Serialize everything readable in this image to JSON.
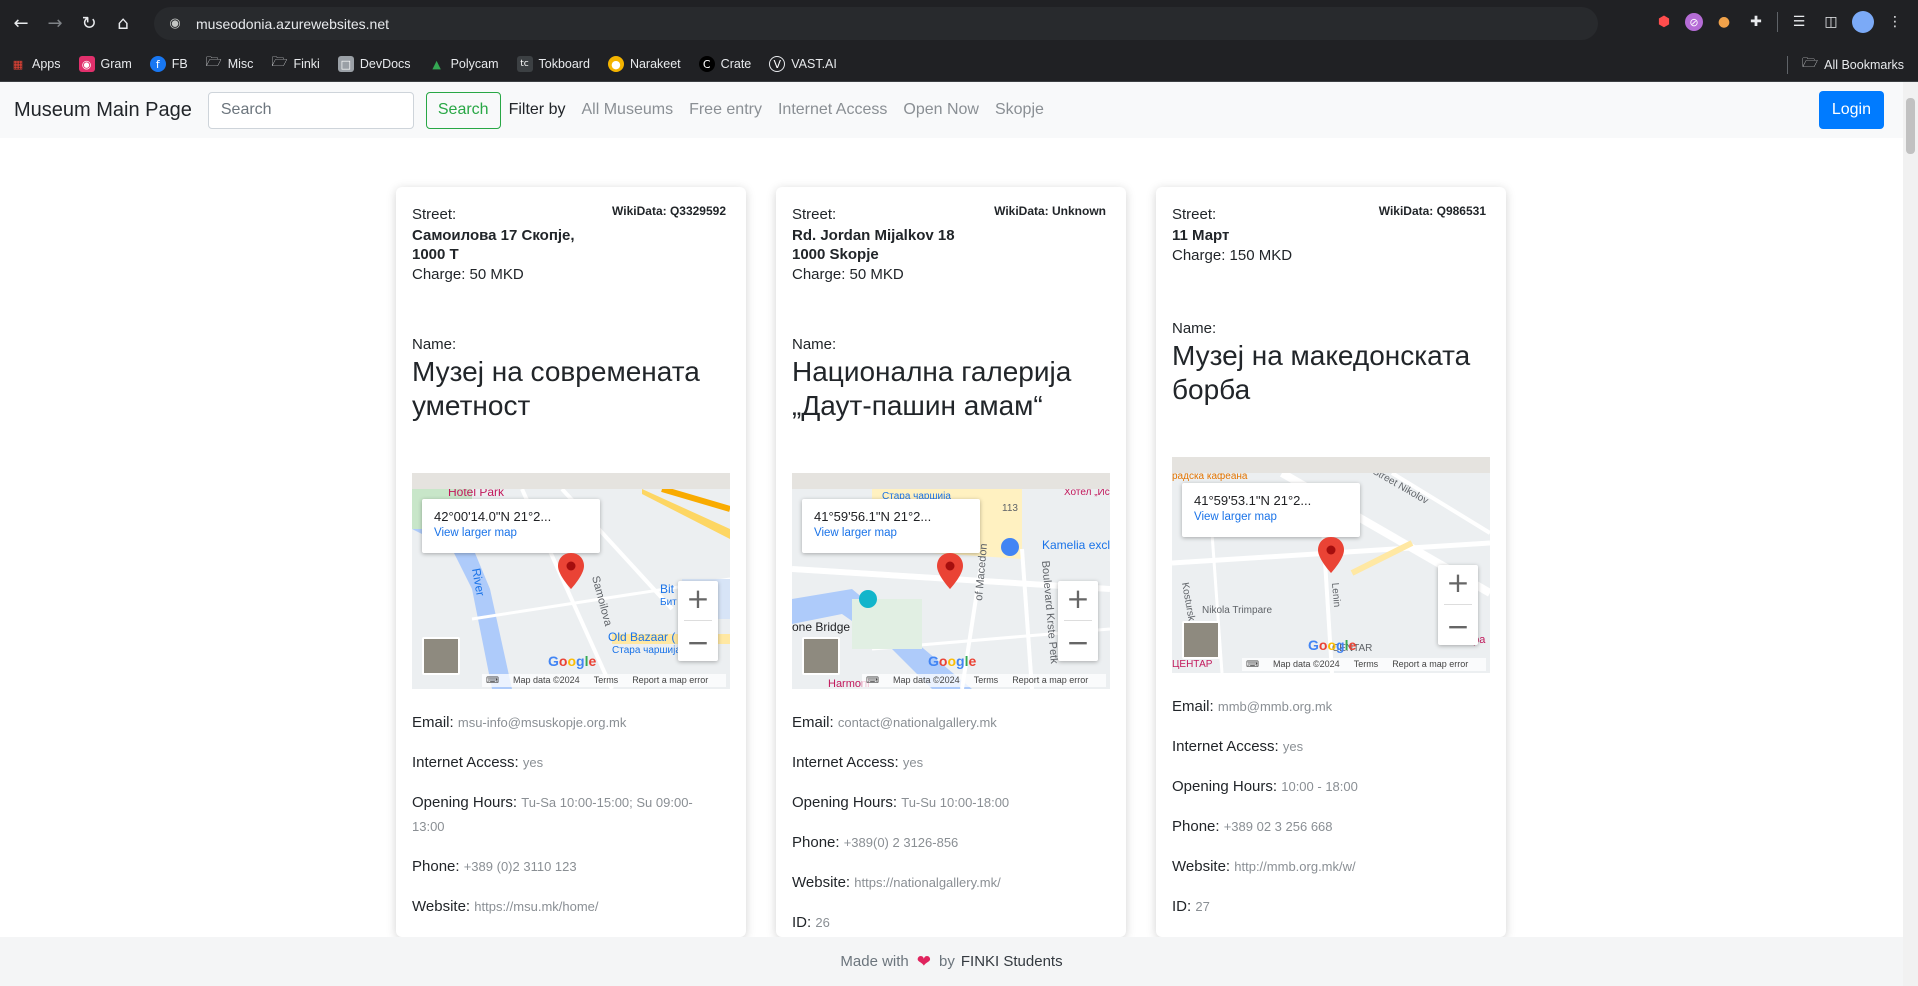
{
  "browser": {
    "url": "museodonia.azurewebsites.net",
    "bookmarks": [
      {
        "label": "Apps",
        "icon": "apps-grid-icon",
        "color": "#ea4335"
      },
      {
        "label": "Gram",
        "icon": "instagram-icon",
        "color": "#e1306c"
      },
      {
        "label": "FB",
        "icon": "facebook-icon",
        "color": "#1877f2"
      },
      {
        "label": "Misc",
        "icon": "folder-icon",
        "color": "#e8eaed"
      },
      {
        "label": "Finki",
        "icon": "folder-icon",
        "color": "#e8eaed"
      },
      {
        "label": "DevDocs",
        "icon": "devdocs-icon",
        "color": "#9aa0a6"
      },
      {
        "label": "Polycam",
        "icon": "polycam-icon",
        "color": "#34a853"
      },
      {
        "label": "Tokboard",
        "icon": "tokboard-icon",
        "color": "#202124"
      },
      {
        "label": "Narakeet",
        "icon": "narakeet-icon",
        "color": "#f4b400"
      },
      {
        "label": "Crate",
        "icon": "crate-icon",
        "color": "#000000"
      },
      {
        "label": "VAST.AI",
        "icon": "vastai-icon",
        "color": "#e8eaed"
      }
    ],
    "all_bookmarks": "All Bookmarks"
  },
  "navbar": {
    "brand": "Museum Main Page",
    "search_placeholder": "Search",
    "search_button": "Search",
    "filter_label": "Filter by",
    "filters": [
      "All Museums",
      "Free entry",
      "Internet Access",
      "Open Now",
      "Skopje"
    ],
    "login": "Login",
    "accent_color": "#007bff",
    "search_color": "#28a745"
  },
  "labels": {
    "street": "Street:",
    "charge": "Charge:",
    "name": "Name:",
    "email": "Email:",
    "internet": "Internet Access:",
    "hours": "Opening Hours:",
    "phone": "Phone:",
    "website": "Website:",
    "id": "ID:",
    "view_larger_map": "View larger map",
    "map_data": "Map data ©2024",
    "terms": "Terms",
    "report": "Report a map error"
  },
  "museums": [
    {
      "wikidata": "WikiData: Q3329592",
      "street_lines": [
        "Самоилова 17 Скопје,",
        "1000 Т"
      ],
      "charge": "50 MKD",
      "name_lines": [
        "Музеј на современата",
        "уметност"
      ],
      "coords": "42°00'14.0\"N 21°2...",
      "map_labels": [
        "Hotel Park",
        "River",
        "Samoilova",
        "Old Bazaar (",
        "Стара чаршија",
        "Bit L",
        "Бит"
      ],
      "email": "msu-info@msuskopje.org.mk",
      "internet": "yes",
      "hours_lines": [
        "Tu-Sa 10:00-15:00; Su 09:00-",
        "13:00"
      ],
      "phone": "+389 (0)2 3110 123",
      "website": "https://msu.mk/home/"
    },
    {
      "wikidata": "WikiData: Unknown",
      "street_lines": [
        "Rd. Jordan Mijalkov 18",
        "1000 Skopje"
      ],
      "charge": "50 MKD",
      "name_lines": [
        "Национална галерија",
        "„Даут-пашин амам“"
      ],
      "coords": "41°59'56.1\"N 21°2...",
      "map_labels": [
        "Стара чаршија",
        "Хотел „Ис",
        "113",
        "Kamelia excl",
        "Boulevard Krste Petk",
        "of Macedon",
        "one Bridge",
        "Harmoni"
      ],
      "email": "contact@nationalgallery.mk",
      "internet": "yes",
      "hours_lines": [
        "Tu-Su 10:00-18:00"
      ],
      "phone": "+389(0) 2 3126-856",
      "website": "https://nationalgallery.mk/",
      "id": "26"
    },
    {
      "wikidata": "WikiData: Q986531",
      "street_lines": [
        "11 Март"
      ],
      "charge": "150 MKD",
      "name_lines": [
        "Музеј на македонската",
        "борба"
      ],
      "coords": "41°59'53.1\"N 21°2...",
      "map_labels": [
        "радска кафеана",
        "Street Nikolov",
        "Kosturska",
        "Lenin",
        "Nikola Trimpare",
        "CENTAR",
        "ЦЕНТАР",
        "apa"
      ],
      "email": "mmb@mmb.org.mk",
      "internet": "yes",
      "hours_lines": [
        "10:00 - 18:00"
      ],
      "phone": "+389 02 3 256 668",
      "website": "http://mmb.org.mk/w/",
      "id": "27"
    }
  ],
  "footer": {
    "made_with": "Made with",
    "by": "by",
    "students": "FINKI Students",
    "heart_color": "#e0245e"
  }
}
